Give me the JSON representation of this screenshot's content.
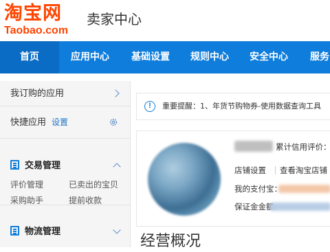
{
  "header": {
    "logo_cn": "淘宝网",
    "logo_en": "Taobao.com",
    "site_name": "卖家中心"
  },
  "nav": {
    "items": [
      {
        "label": "首页",
        "active": true
      },
      {
        "label": "应用中心",
        "active": false
      },
      {
        "label": "基础设置",
        "active": false
      },
      {
        "label": "规则中心",
        "active": false
      },
      {
        "label": "安全中心",
        "active": false
      },
      {
        "label": "服务",
        "active": false
      }
    ]
  },
  "sidebar": {
    "my_apps": "我订购的应用",
    "quick_apps": "快捷应用",
    "settings_link": "设置",
    "trade": {
      "title": "交易管理",
      "links": [
        "评价管理",
        "已卖出的宝贝",
        "采购助手",
        "提前收款"
      ]
    },
    "logistics": {
      "title": "物流管理"
    }
  },
  "notice": {
    "icon": "!",
    "text": "重要提醒：1、年货节购物券-使用数据查询工具"
  },
  "account": {
    "credit_label": "累计信用评价：",
    "shop_settings": "店铺设置",
    "view_shop": "查看淘宝店铺",
    "alipay_label": "我的支付宝：",
    "deposit_label": "保证金金额："
  },
  "overview_title": "经营概况",
  "colors": {
    "brand": "#ff4400",
    "nav_bg": "#0f7ddc",
    "nav_active": "#0a6cc4",
    "link": "#1a73c8"
  }
}
